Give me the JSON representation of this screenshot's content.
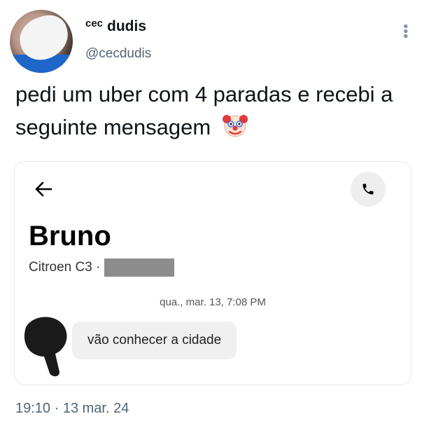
{
  "tweet": {
    "display_name_prefix": "cec",
    "display_name": "dudis",
    "handle": "@cecdudis",
    "text": "pedi um uber com 4 paradas e recebi a seguinte mensagem",
    "timestamp": "19:10 · 13 mar. 24"
  },
  "chat": {
    "contact_name": "Bruno",
    "vehicle": "Citroen C3 ·",
    "message_time": "qua., mar. 13, 7:08 PM",
    "message_text": "vão conhecer a cidade"
  },
  "icons": {
    "more": "more-vertical-icon",
    "back": "arrow-left-icon",
    "call": "phone-icon",
    "emoji": "clown-face-icon"
  }
}
